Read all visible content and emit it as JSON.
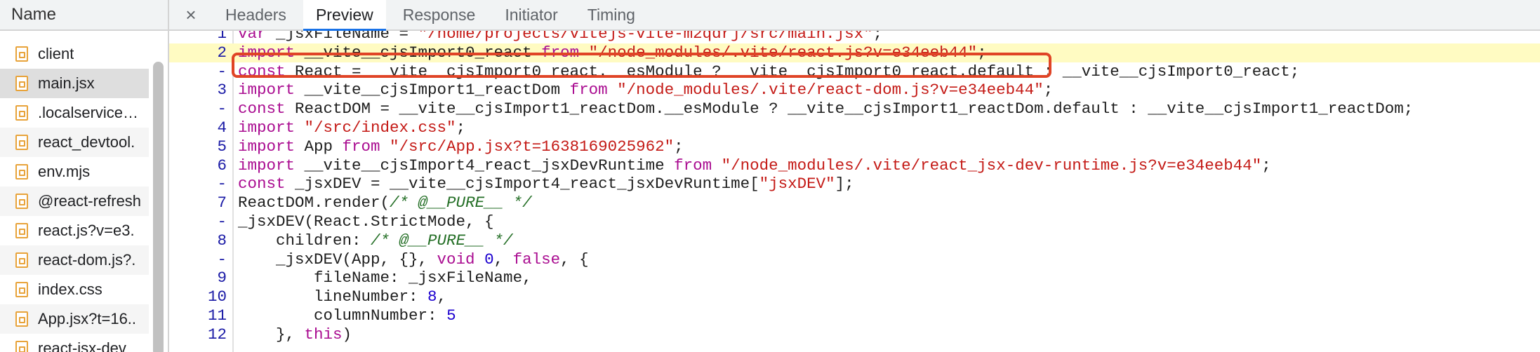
{
  "left_panel": {
    "header": "Name",
    "requests": [
      {
        "label": "client"
      },
      {
        "label": "main.jsx",
        "selected": true
      },
      {
        "label": ".localservice…"
      },
      {
        "label": "react_devtool."
      },
      {
        "label": "env.mjs"
      },
      {
        "label": "@react-refresh"
      },
      {
        "label": "react.js?v=e3."
      },
      {
        "label": "react-dom.js?."
      },
      {
        "label": "index.css"
      },
      {
        "label": "App.jsx?t=16.."
      },
      {
        "label": "react-jsx-dev"
      }
    ],
    "file_icon": "file-icon"
  },
  "tabs": {
    "close": "×",
    "items": [
      "Headers",
      "Preview",
      "Response",
      "Initiator",
      "Timing"
    ],
    "active": "Preview"
  },
  "code": {
    "lines": [
      {
        "ln": "1",
        "tokens": [
          [
            "kw",
            "var "
          ],
          [
            "plain",
            "_jsxFileName = "
          ],
          [
            "str",
            "\"/home/projects/vitejs-vite-m2qdrj/src/main.jsx\""
          ],
          [
            "plain",
            ";"
          ]
        ]
      },
      {
        "ln": "2",
        "highlight": true,
        "tokens": [
          [
            "kw",
            "import "
          ],
          [
            "plain",
            "__vite__cjsImport0_react "
          ],
          [
            "kw",
            "from "
          ],
          [
            "str",
            "\"/node_modules/.vite/react.js?v=e34eeb44\""
          ],
          [
            "plain",
            ";"
          ]
        ]
      },
      {
        "ln": "-",
        "tokens": [
          [
            "kw",
            "const "
          ],
          [
            "plain",
            "React = __vite__cjsImport0_react.__esModule ? __vite__cjsImport0_react.default : __vite__cjsImport0_react;"
          ]
        ]
      },
      {
        "ln": "3",
        "tokens": [
          [
            "kw",
            "import "
          ],
          [
            "plain",
            "__vite__cjsImport1_reactDom "
          ],
          [
            "kw",
            "from "
          ],
          [
            "str",
            "\"/node_modules/.vite/react-dom.js?v=e34eeb44\""
          ],
          [
            "plain",
            ";"
          ]
        ]
      },
      {
        "ln": "-",
        "tokens": [
          [
            "kw",
            "const "
          ],
          [
            "plain",
            "ReactDOM = __vite__cjsImport1_reactDom.__esModule ? __vite__cjsImport1_reactDom.default : __vite__cjsImport1_reactDom;"
          ]
        ]
      },
      {
        "ln": "4",
        "tokens": [
          [
            "kw",
            "import "
          ],
          [
            "str",
            "\"/src/index.css\""
          ],
          [
            "plain",
            ";"
          ]
        ]
      },
      {
        "ln": "5",
        "tokens": [
          [
            "kw",
            "import "
          ],
          [
            "plain",
            "App "
          ],
          [
            "kw",
            "from "
          ],
          [
            "str",
            "\"/src/App.jsx?t=1638169025962\""
          ],
          [
            "plain",
            ";"
          ]
        ]
      },
      {
        "ln": "6",
        "tokens": [
          [
            "kw",
            "import "
          ],
          [
            "plain",
            "__vite__cjsImport4_react_jsxDevRuntime "
          ],
          [
            "kw",
            "from "
          ],
          [
            "str",
            "\"/node_modules/.vite/react_jsx-dev-runtime.js?v=e34eeb44\""
          ],
          [
            "plain",
            ";"
          ]
        ]
      },
      {
        "ln": "-",
        "tokens": [
          [
            "kw",
            "const "
          ],
          [
            "plain",
            "_jsxDEV = __vite__cjsImport4_react_jsxDevRuntime["
          ],
          [
            "str",
            "\"jsxDEV\""
          ],
          [
            "plain",
            "];"
          ]
        ]
      },
      {
        "ln": "7",
        "tokens": [
          [
            "plain",
            "ReactDOM.render("
          ],
          [
            "cmt",
            "/* @__PURE__ */"
          ]
        ]
      },
      {
        "ln": "-",
        "tokens": [
          [
            "plain",
            "_jsxDEV(React.StrictMode, {"
          ]
        ]
      },
      {
        "ln": "8",
        "tokens": [
          [
            "plain",
            "    children: "
          ],
          [
            "cmt",
            "/* @__PURE__ */"
          ]
        ]
      },
      {
        "ln": "-",
        "tokens": [
          [
            "plain",
            "    _jsxDEV(App, {}, "
          ],
          [
            "kw",
            "void "
          ],
          [
            "num",
            "0"
          ],
          [
            "plain",
            ", "
          ],
          [
            "kw",
            "false"
          ],
          [
            "plain",
            ", {"
          ]
        ]
      },
      {
        "ln": "9",
        "tokens": [
          [
            "plain",
            "        fileName: _jsxFileName,"
          ]
        ]
      },
      {
        "ln": "10",
        "tokens": [
          [
            "plain",
            "        lineNumber: "
          ],
          [
            "num",
            "8"
          ],
          [
            "plain",
            ","
          ]
        ]
      },
      {
        "ln": "11",
        "tokens": [
          [
            "plain",
            "        columnNumber: "
          ],
          [
            "num",
            "5"
          ]
        ]
      },
      {
        "ln": "12",
        "tokens": [
          [
            "plain",
            "    }, "
          ],
          [
            "kw",
            "this"
          ],
          [
            "plain",
            ")"
          ]
        ]
      }
    ]
  },
  "colors": {
    "highlight_border": "#e04426",
    "highlight_bg": "#fffbc2",
    "active_tab_underline": "#1a73e8"
  }
}
